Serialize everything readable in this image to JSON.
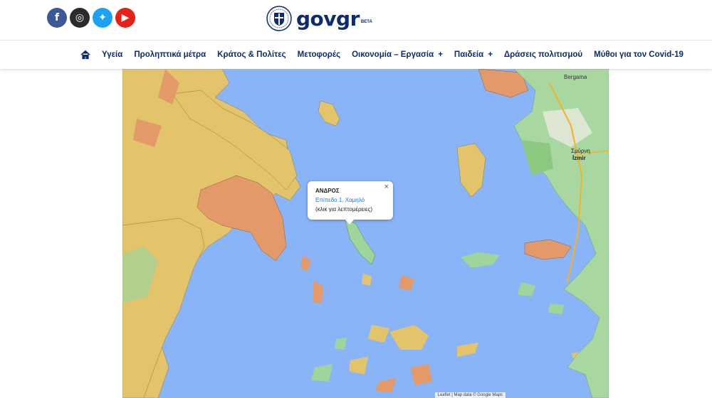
{
  "social": [
    {
      "name": "facebook",
      "glyph": "f",
      "color": "#3b5998"
    },
    {
      "name": "instagram",
      "glyph": "◎",
      "color": "#2b2b2b"
    },
    {
      "name": "twitter",
      "glyph": "✦",
      "color": "#1da1f2"
    },
    {
      "name": "youtube",
      "glyph": "▶",
      "color": "#e62117"
    }
  ],
  "logo": {
    "text": "govgr",
    "beta": "BETA"
  },
  "nav": {
    "home_icon": "home-icon",
    "items": [
      {
        "label": "Υγεία",
        "plus": false
      },
      {
        "label": "Προληπτικά μέτρα",
        "plus": false
      },
      {
        "label": "Κράτος & Πολίτες",
        "plus": false
      },
      {
        "label": "Μετοφορές",
        "plus": false
      },
      {
        "label": "Οικονομία – Εργασία",
        "plus": true
      },
      {
        "label": "Παιδεία",
        "plus": true
      },
      {
        "label": "Δράσεις πολιτισμού",
        "plus": false
      },
      {
        "label": "Μύθοι για τον Covid-19",
        "plus": false
      }
    ]
  },
  "map": {
    "labels": {
      "bergama": "Bergama",
      "smyrni": "Σμύρνη",
      "izmir": "İzmir"
    },
    "popup": {
      "title": "ΑΝΔΡΟΣ",
      "level": "Επίπεδο 1, Χαμηλό",
      "more": "(κλικ για λεπτομέρειες)",
      "close": "×"
    },
    "attribution": "Leaflet | Map data © Google Maps"
  },
  "colors": {
    "sea": "#8ab4f8",
    "yellow": "#e3c46a",
    "orange": "#e39a68",
    "green": "#9fd49a",
    "navy": "#0d2b6f"
  }
}
